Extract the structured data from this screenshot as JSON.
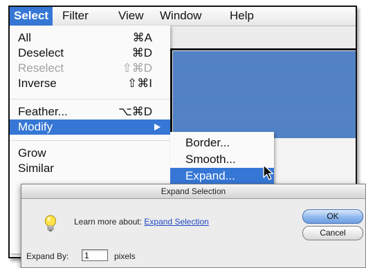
{
  "menubar": {
    "items": [
      {
        "label": "Select"
      },
      {
        "label": "Filter"
      },
      {
        "label": "View"
      },
      {
        "label": "Window"
      },
      {
        "label": "Help"
      }
    ]
  },
  "select_menu": {
    "items": [
      {
        "label": "All",
        "shortcut": "⌘A",
        "enabled": true
      },
      {
        "label": "Deselect",
        "shortcut": "⌘D",
        "enabled": true
      },
      {
        "label": "Reselect",
        "shortcut": "⇧⌘D",
        "enabled": false
      },
      {
        "label": "Inverse",
        "shortcut": "⇧⌘I",
        "enabled": true
      },
      {
        "label": "Feather...",
        "shortcut": "⌥⌘D",
        "enabled": true
      },
      {
        "label": "Modify",
        "shortcut": "",
        "enabled": true,
        "highlighted": true
      },
      {
        "label": "Grow",
        "shortcut": "",
        "enabled": true
      },
      {
        "label": "Similar",
        "shortcut": "",
        "enabled": true
      }
    ]
  },
  "modify_submenu": {
    "items": [
      {
        "label": "Border..."
      },
      {
        "label": "Smooth..."
      },
      {
        "label": "Expand...",
        "highlighted": true
      }
    ]
  },
  "dialog": {
    "title": "Expand Selection",
    "learn_text": "Learn more about:",
    "learn_link": "Expand Selection",
    "ok_label": "OK",
    "cancel_label": "Cancel",
    "expand_label": "Expand By:",
    "expand_value": "1",
    "unit_label": "pixels"
  },
  "colors": {
    "menu_highlight": "#3677d6",
    "selection_fill": "#4f7fc4"
  }
}
